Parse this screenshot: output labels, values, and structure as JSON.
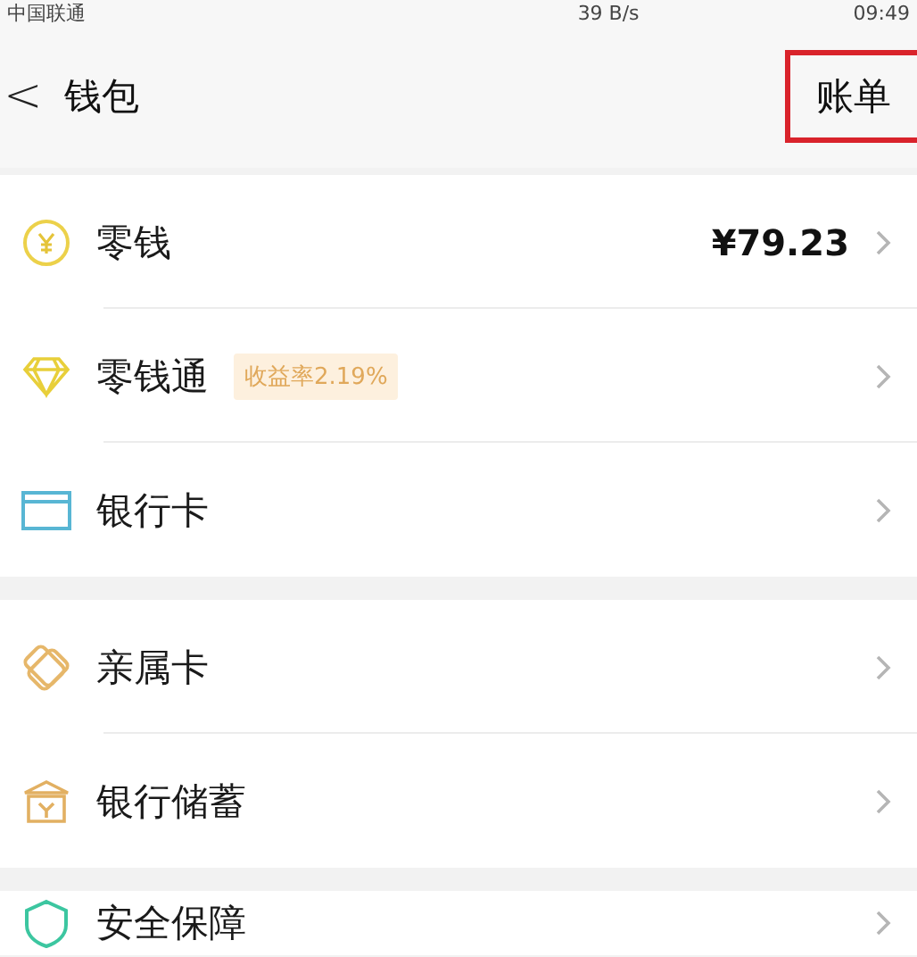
{
  "status_bar": {
    "carrier": "中国联通",
    "speed": "39 B/s",
    "time": "09:49"
  },
  "header": {
    "back": "<",
    "title": "钱包",
    "action": {
      "label": "账单",
      "highlighted": true
    }
  },
  "groups": [
    {
      "items": [
        {
          "kind": "coin",
          "label": "零钱",
          "value": "¥79.23"
        },
        {
          "kind": "diamond",
          "label": "零钱通",
          "badge": "收益率2.19%"
        },
        {
          "kind": "card",
          "label": "银行卡"
        }
      ]
    },
    {
      "items": [
        {
          "kind": "family",
          "label": "亲属卡"
        },
        {
          "kind": "bank",
          "label": "银行储蓄"
        }
      ]
    },
    {
      "items": [
        {
          "kind": "shield",
          "label": "安全保障"
        }
      ]
    }
  ]
}
